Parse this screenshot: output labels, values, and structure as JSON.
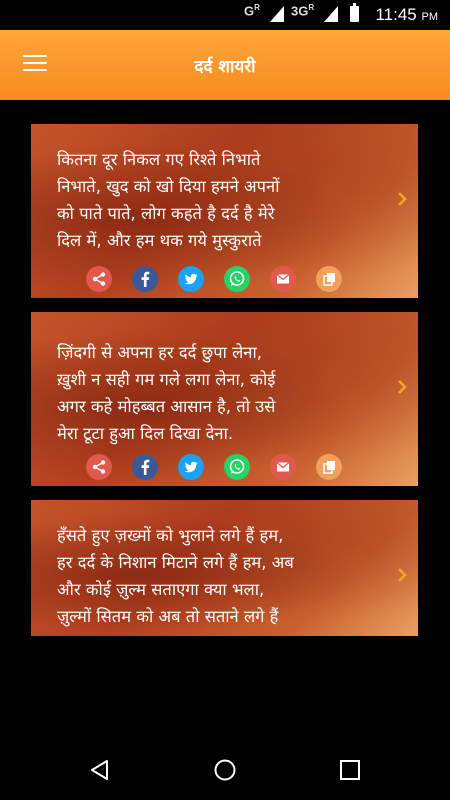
{
  "status_bar": {
    "network_1": "G",
    "roaming_1": "R",
    "network_2": "3G",
    "roaming_2": "R",
    "time": "11:45",
    "ampm": "PM"
  },
  "app_bar": {
    "title": "दर्द शायरी"
  },
  "cards": [
    {
      "lines": [
        "कितना दूर निकल गए रिश्ते निभाते",
        "निभाते, खुद को खो दिया हमने अपनों",
        "को पाते पाते, लोग कहते है दर्द है मेरे",
        "दिल में, और हम थक गये मुस्कुराते"
      ]
    },
    {
      "lines": [
        "ज़िंदगी से अपना हर दर्द छुपा लेना,",
        "ख़ुशी न सही गम गले लगा लेना, कोई",
        "अगर कहे मोहब्बत आसान है, तो उसे",
        "मेरा टूटा हुआ दिल दिखा देना."
      ]
    },
    {
      "lines": [
        "हँसते हुए ज़ख्मों को भुलाने लगे हैं हम,",
        "हर दर्द के निशान मिटाने लगे हैं हम, अब",
        "और कोई ज़ुल्म सताएगा क्या भला,",
        "ज़ुल्मों सितम को अब तो सताने लगे हैं"
      ]
    }
  ],
  "share_icons": [
    "share-icon",
    "facebook-icon",
    "twitter-icon",
    "whatsapp-icon",
    "email-icon",
    "copy-icon"
  ],
  "colors": {
    "app_bar": "#f68b1e",
    "share": "#e05a4e",
    "facebook": "#3b5998",
    "twitter": "#1da1f2",
    "whatsapp": "#25d366",
    "email": "#e05a4e",
    "copy": "#f2a05a",
    "chevron": "#f5a623"
  }
}
